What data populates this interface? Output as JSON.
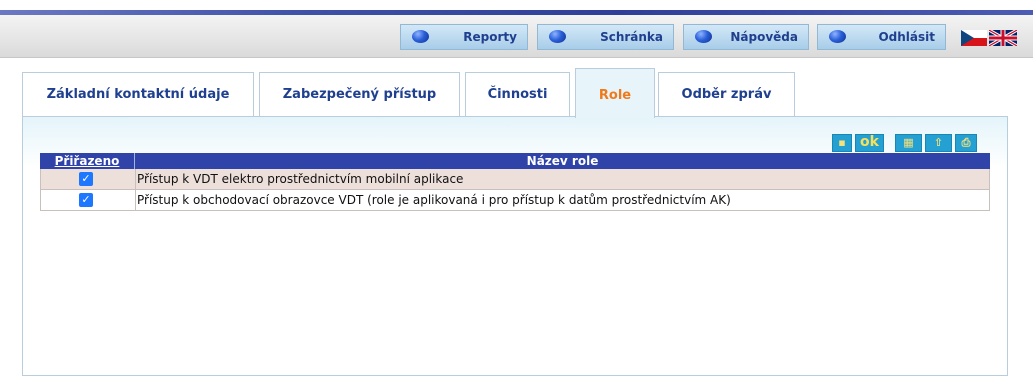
{
  "nav": {
    "reports": "Reporty",
    "inbox": "Schránka",
    "help": "Nápověda",
    "logout": "Odhlásit"
  },
  "languages": [
    "cs",
    "en"
  ],
  "tabs": [
    {
      "label": "Základní kontaktní údaje",
      "active": false
    },
    {
      "label": "Zabezpečený přístup",
      "active": false
    },
    {
      "label": "Činnosti",
      "active": false
    },
    {
      "label": "Role",
      "active": true
    },
    {
      "label": "Odběr zpráv",
      "active": false
    }
  ],
  "toolbar_icons": [
    "settings-icon",
    "ok-icon",
    "export-excel-icon",
    "import-icon",
    "print-icon"
  ],
  "toolbar_ok": "ok",
  "table": {
    "columns": [
      "Přiřazeno",
      "Název role"
    ],
    "rows": [
      {
        "assigned": true,
        "name": "Přístup k VDT elektro prostřednictvím mobilní aplikace"
      },
      {
        "assigned": true,
        "name": "Přístup k obchodovací obrazovce VDT (role je aplikovaná i pro přístup k datům prostřednictvím AK)"
      }
    ]
  },
  "colors": {
    "header_blue": "#2f43a8",
    "active_tab_text": "#f07a1b",
    "tab_text": "#1f3f8f",
    "selected_row": "#ede0db"
  }
}
